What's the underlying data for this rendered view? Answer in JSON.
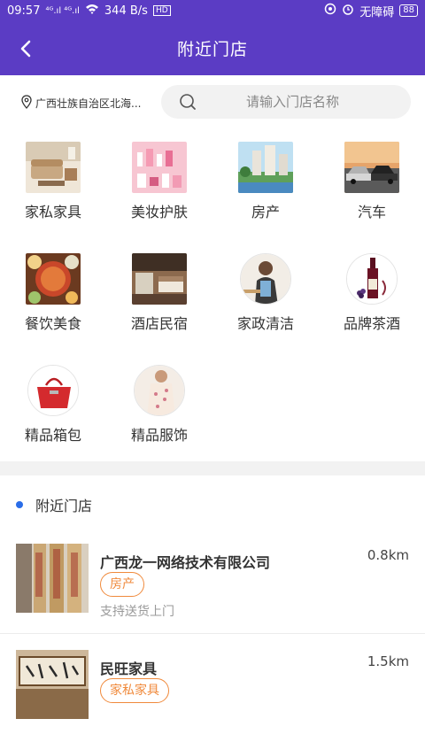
{
  "status": {
    "time": "09:57",
    "signal": "⁴ᴳ.ıl ⁴ᴳ.ıl",
    "speed": "344 B/s",
    "hd": "HD",
    "accessibility": "无障碍",
    "battery": "88"
  },
  "nav": {
    "title": "附近门店"
  },
  "location": {
    "text": "广西壮族自治区北海..."
  },
  "search": {
    "placeholder": "请输入门店名称"
  },
  "categories": [
    {
      "label": "家私家具",
      "icon": "furniture"
    },
    {
      "label": "美妆护肤",
      "icon": "cosmetics"
    },
    {
      "label": "房产",
      "icon": "real-estate"
    },
    {
      "label": "汽车",
      "icon": "car"
    },
    {
      "label": "餐饮美食",
      "icon": "food"
    },
    {
      "label": "酒店民宿",
      "icon": "hotel"
    },
    {
      "label": "家政清洁",
      "icon": "cleaning"
    },
    {
      "label": "品牌茶酒",
      "icon": "wine"
    },
    {
      "label": "精品箱包",
      "icon": "bag"
    },
    {
      "label": "精品服饰",
      "icon": "clothing"
    }
  ],
  "nearby": {
    "title": "附近门店",
    "stores": [
      {
        "name": "广西龙一网络技术有限公司",
        "distance": "0.8km",
        "tag": "房产",
        "note": "支持送货上门"
      },
      {
        "name": "民旺家具",
        "distance": "1.5km",
        "tag": "家私家具",
        "note": ""
      }
    ]
  },
  "colors": {
    "primary": "#5b3cc4",
    "accent": "#f08a3c",
    "dot": "#2a6de8"
  }
}
